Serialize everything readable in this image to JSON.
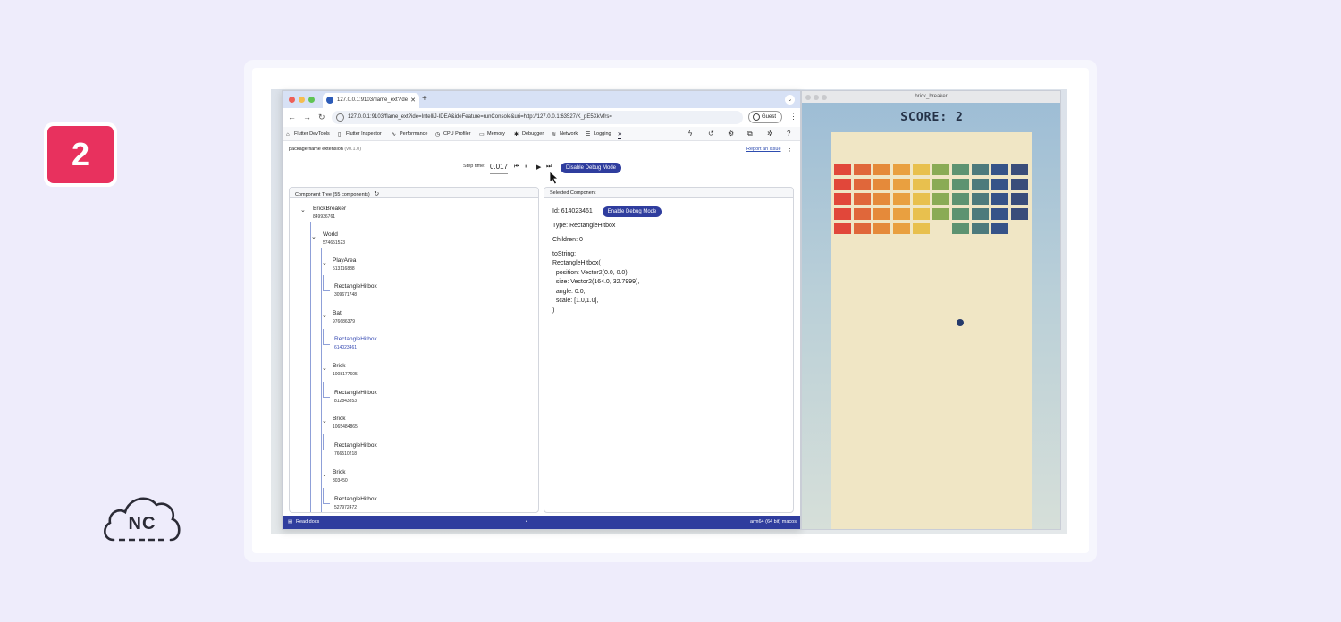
{
  "slide": {
    "step_number": "2",
    "logo_text": "NC"
  },
  "browser": {
    "tab_title": "127.0.0.1:9103/flame_ext?ide",
    "url": "127.0.0.1:9103/flame_ext?ide=IntelliJ-IDEA&ideFeature=runConsole&uri=http://127.0.0.1:63527/K_pE5XkVfrs=",
    "profile_label": "Guest"
  },
  "devtools": {
    "tabs": [
      {
        "label": "Flutter DevTools",
        "icon": "flutter-icon"
      },
      {
        "label": "Flutter Inspector",
        "icon": "phone-icon"
      },
      {
        "label": "Performance",
        "icon": "pulse-icon"
      },
      {
        "label": "CPU Profiler",
        "icon": "timer-icon"
      },
      {
        "label": "Memory",
        "icon": "memory-icon"
      },
      {
        "label": "Debugger",
        "icon": "bug-icon"
      },
      {
        "label": "Network",
        "icon": "wifi-icon"
      },
      {
        "label": "Logging",
        "icon": "list-icon"
      }
    ],
    "more_label": "»",
    "package_name": "package:flame extension",
    "package_version": "(v0.1.0)",
    "report_link": "Report an issue",
    "step_time_label": "Step time:",
    "step_time_value": "0.017",
    "disable_debug_label": "Disable Debug Mode",
    "status_left": "Read docs",
    "status_mid": "•",
    "status_right": "arm64 (64 bit) macos"
  },
  "component_tree": {
    "header": "Component Tree (55 components)",
    "nodes": [
      {
        "name": "BrickBreaker",
        "id": "849936761"
      },
      {
        "name": "World",
        "id": "574651523"
      },
      {
        "name": "PlayArea",
        "id": "513116888"
      },
      {
        "name": "RectangleHitbox",
        "id": "309671748"
      },
      {
        "name": "Bat",
        "id": "976686379"
      },
      {
        "name": "RectangleHitbox",
        "id": "614023461"
      },
      {
        "name": "Brick",
        "id": "1008177605"
      },
      {
        "name": "RectangleHitbox",
        "id": "812843853"
      },
      {
        "name": "Brick",
        "id": "1065484865"
      },
      {
        "name": "RectangleHitbox",
        "id": "766510218"
      },
      {
        "name": "Brick",
        "id": "303450"
      },
      {
        "name": "RectangleHitbox",
        "id": "527972472"
      }
    ]
  },
  "selected_component": {
    "header": "Selected Component",
    "id_line": "Id: 614023461",
    "enable_debug_label": "Enable Debug Mode",
    "type_line": "Type: RectangleHitbox",
    "children_line": "Children: 0",
    "tostring_label": "toString:",
    "tostring_value": "RectangleHitbox(\n  position: Vector2(0.0, 0.0),\n  size: Vector2(164.0, 32.7999),\n  angle: 0.0,\n  scale: [1.0,1.0],\n)"
  },
  "game": {
    "window_title": "brick_breaker",
    "score_text": "SCORE: 2",
    "brick_colors": [
      "#e1473a",
      "#e0673a",
      "#e58a3a",
      "#e9a040",
      "#e8c04e",
      "#8aab55",
      "#5d9371",
      "#4d7a7c",
      "#365388",
      "#3a4d7a"
    ],
    "brick_grid": [
      [
        1,
        1,
        1,
        1,
        1,
        1,
        1,
        1,
        1,
        1
      ],
      [
        1,
        1,
        1,
        1,
        1,
        1,
        1,
        1,
        1,
        1
      ],
      [
        1,
        1,
        1,
        1,
        1,
        1,
        1,
        1,
        1,
        1
      ],
      [
        1,
        1,
        1,
        1,
        1,
        1,
        1,
        1,
        1,
        1
      ],
      [
        1,
        1,
        1,
        1,
        1,
        0,
        1,
        1,
        1,
        0
      ]
    ]
  }
}
